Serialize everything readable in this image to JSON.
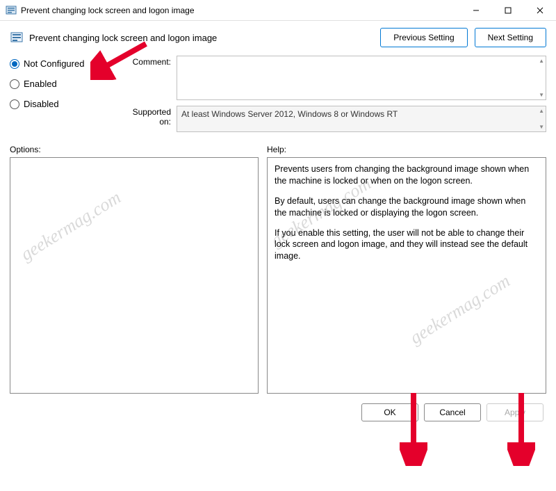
{
  "window": {
    "title": "Prevent changing lock screen and logon image"
  },
  "header": {
    "title": "Prevent changing lock screen and logon image",
    "prev_btn": "Previous Setting",
    "next_btn": "Next Setting"
  },
  "radios": {
    "not_configured": "Not Configured",
    "enabled": "Enabled",
    "disabled": "Disabled"
  },
  "fields": {
    "comment_label": "Comment:",
    "supported_label": "Supported on:",
    "supported_text": "At least Windows Server 2012, Windows 8 or Windows RT"
  },
  "labels": {
    "options": "Options:",
    "help": "Help:"
  },
  "help": {
    "p1": "Prevents users from changing the background image shown when the machine is locked or when on the logon screen.",
    "p2": "By default, users can change the background image shown when the machine is locked or displaying the logon screen.",
    "p3": "If you enable this setting, the user will not be able to change their lock screen and logon image, and they will instead see the default image."
  },
  "buttons": {
    "ok": "OK",
    "cancel": "Cancel",
    "apply": "Apply"
  },
  "watermark": "geekermag.com"
}
